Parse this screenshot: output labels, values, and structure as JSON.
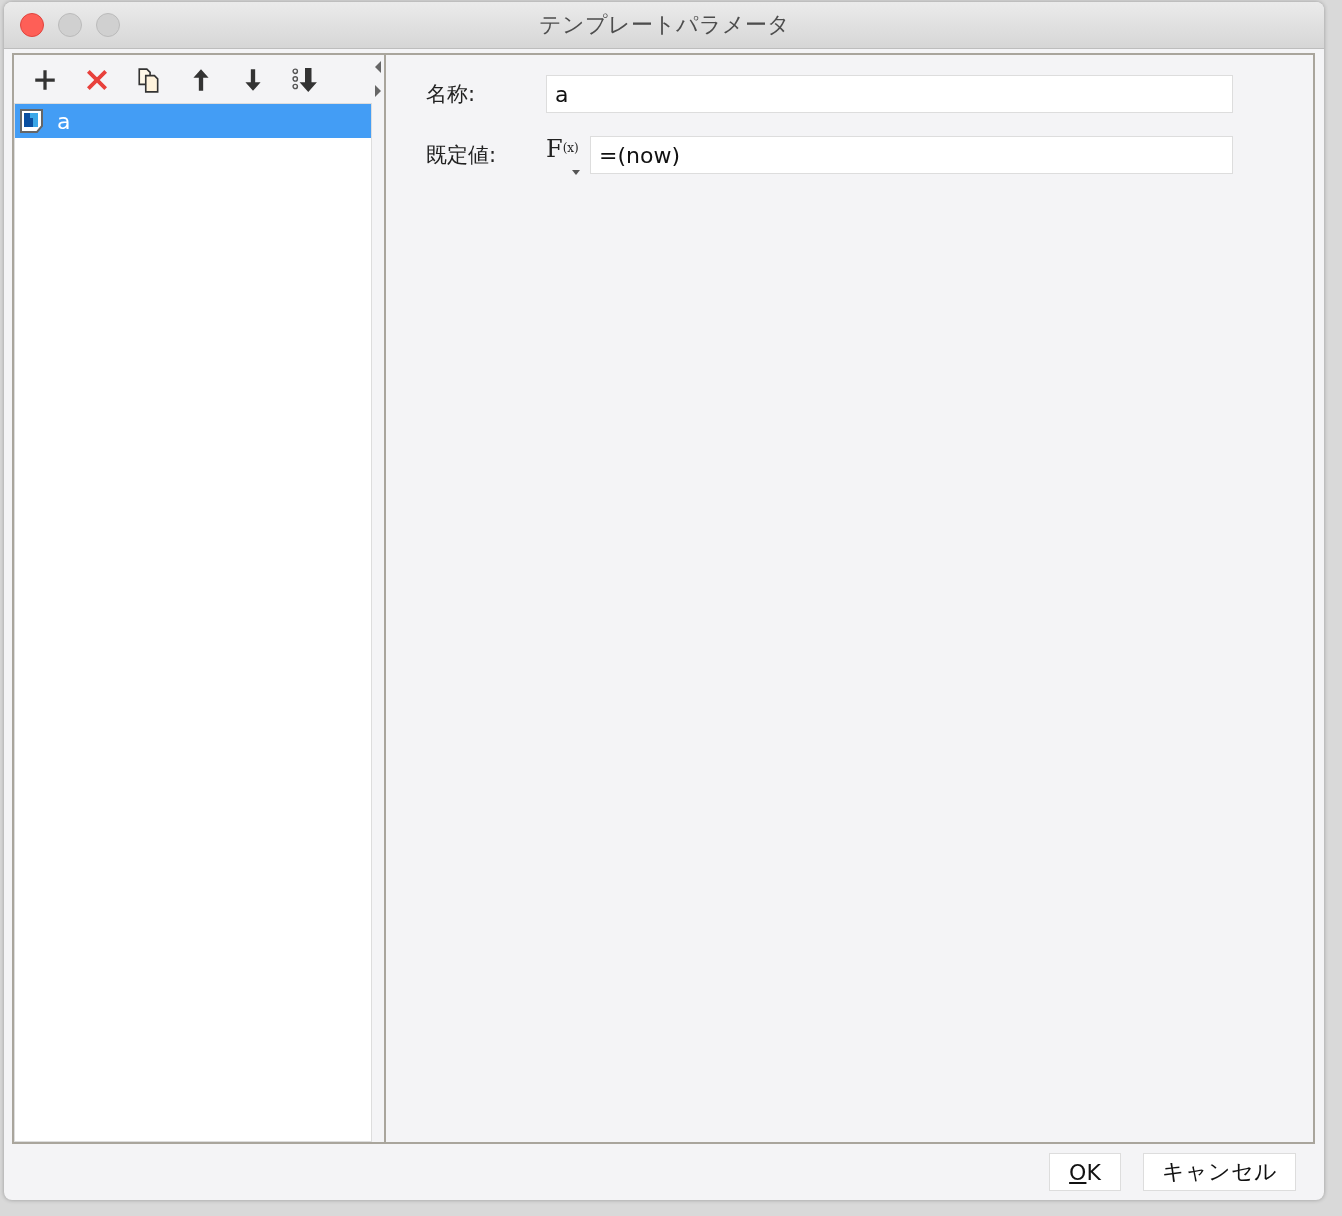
{
  "window": {
    "title": "テンプレートパラメータ"
  },
  "toolbar": [
    {
      "kind": "add"
    },
    {
      "kind": "delete"
    },
    {
      "kind": "copy"
    },
    {
      "kind": "up"
    },
    {
      "kind": "down"
    },
    {
      "kind": "sort"
    }
  ],
  "parameters": [
    {
      "label": "a",
      "selected": true
    }
  ],
  "form": {
    "name_label": "名称:",
    "name_value": "a",
    "default_label": "既定値:",
    "formula_button": {
      "symbol": "F",
      "argument": "(x)"
    },
    "default_value": "=(now)"
  },
  "buttons": [
    {
      "label": "OK",
      "mnemonic_underline": true
    },
    {
      "label": "キャンセル"
    }
  ]
}
